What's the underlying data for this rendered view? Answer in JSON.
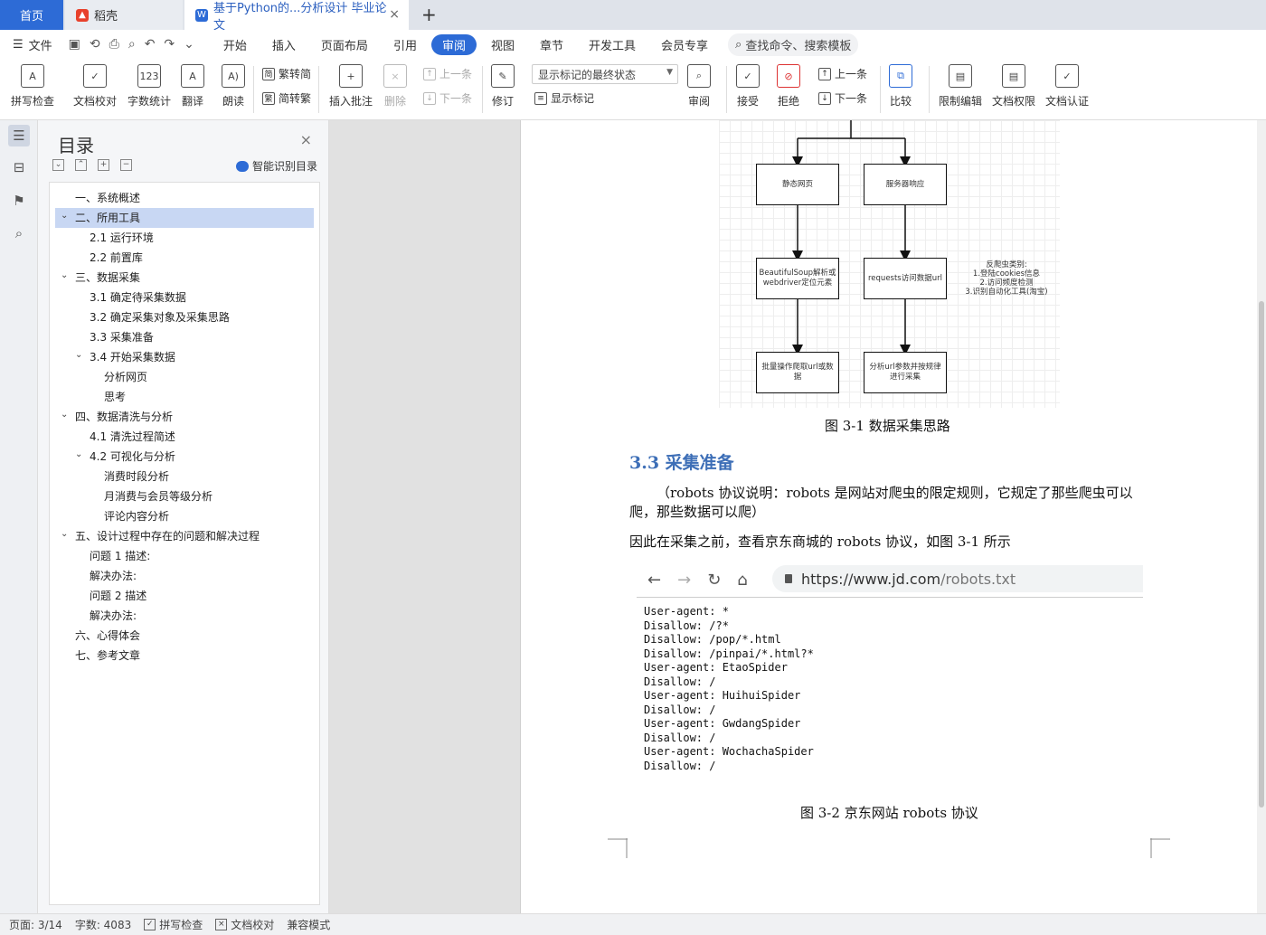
{
  "tabs": {
    "home": "首页",
    "daoke": "稻壳",
    "doc": "基于Python的...分析设计 毕业论文"
  },
  "menubar": {
    "file": "文件",
    "items": [
      "开始",
      "插入",
      "页面布局",
      "引用",
      "审阅",
      "视图",
      "章节",
      "开发工具",
      "会员专享"
    ],
    "active": "审阅",
    "search": "查找命令、搜索模板"
  },
  "ribbon": {
    "spell": "拼写检查",
    "proof": "文档校对",
    "wordcount": "字数统计",
    "translate": "翻译",
    "read": "朗读",
    "trad": "繁转简",
    "simp": "简转繁",
    "insert_comment": "插入批注",
    "delete": "删除",
    "prev_comment": "上一条",
    "next_comment": "下一条",
    "track": "修订",
    "display_state": "显示标记的最终状态",
    "show_marks": "显示标记",
    "review": "审阅",
    "accept": "接受",
    "reject": "拒绝",
    "prev": "上一条",
    "next": "下一条",
    "compare": "比较",
    "restrict": "限制编辑",
    "rights": "文档权限",
    "certify": "文档认证"
  },
  "toc": {
    "title": "目录",
    "smart": "智能识别目录",
    "items": [
      {
        "label": "一、系统概述",
        "level": 1
      },
      {
        "label": "二、所用工具",
        "level": 1
      },
      {
        "label": "2.1 运行环境",
        "level": 2
      },
      {
        "label": "2.2 前置库",
        "level": 2
      },
      {
        "label": "三、数据采集",
        "level": 1
      },
      {
        "label": "3.1 确定待采集数据",
        "level": 2
      },
      {
        "label": "3.2 确定采集对象及采集思路",
        "level": 2
      },
      {
        "label": "3.3 采集准备",
        "level": 2
      },
      {
        "label": "3.4 开始采集数据",
        "level": 2
      },
      {
        "label": "分析网页",
        "level": 3
      },
      {
        "label": "思考",
        "level": 3
      },
      {
        "label": "四、数据清洗与分析",
        "level": 1
      },
      {
        "label": "4.1 清洗过程简述",
        "level": 2
      },
      {
        "label": "4.2 可视化与分析",
        "level": 2
      },
      {
        "label": "消费时段分析",
        "level": 3
      },
      {
        "label": "月消费与会员等级分析",
        "level": 3
      },
      {
        "label": "评论内容分析",
        "level": 3
      },
      {
        "label": "五、设计过程中存在的问题和解决过程",
        "level": 1
      },
      {
        "label": "问题 1 描述:",
        "level": 2
      },
      {
        "label": "解决办法:",
        "level": 2
      },
      {
        "label": "问题 2 描述",
        "level": 2
      },
      {
        "label": "解决办法:",
        "level": 2
      },
      {
        "label": "六、心得体会",
        "level": 1
      },
      {
        "label": "七、参考文章",
        "level": 1
      }
    ]
  },
  "flowchart": {
    "static_page": "静态网页",
    "server_response": "服务器响应",
    "bs_parse": "BeautifulSoup解析或webdriver定位元素",
    "requests": "requests访问数据url",
    "anti_title": "反爬虫类别:",
    "anti_1": "1.登陆cookies信息",
    "anti_2": "2.访问频度检测",
    "anti_3": "3.识别自动化工具(淘宝)",
    "batch": "批量操作爬取url或数据",
    "analyze": "分析url参数并按规律进行采集"
  },
  "document": {
    "fig1_caption": "图 3-1 数据采集思路",
    "heading": "3.3 采集准备",
    "para1": "（robots 协议说明：robots 是网站对爬虫的限定规则，它规定了那些爬虫可以爬，那些数据可以爬）",
    "para2": "因此在采集之前，查看京东商城的 robots 协议，如图 3-1 所示",
    "url_main": "https://www.jd.com",
    "url_path": "/robots.txt",
    "robots": [
      "User-agent: *",
      "Disallow: /?*",
      "Disallow: /pop/*.html",
      "Disallow: /pinpai/*.html?*",
      "User-agent: EtaoSpider",
      "Disallow: /",
      "User-agent: HuihuiSpider",
      "Disallow: /",
      "User-agent: GwdangSpider",
      "Disallow: /",
      "User-agent: WochachaSpider",
      "Disallow: /"
    ],
    "fig2_caption": "图 3-2 京东网站 robots 协议"
  },
  "status": {
    "page": "页面: 3/14",
    "words": "字数: 4083",
    "spell": "拼写检查",
    "proof": "文档校对",
    "compat": "兼容模式"
  }
}
